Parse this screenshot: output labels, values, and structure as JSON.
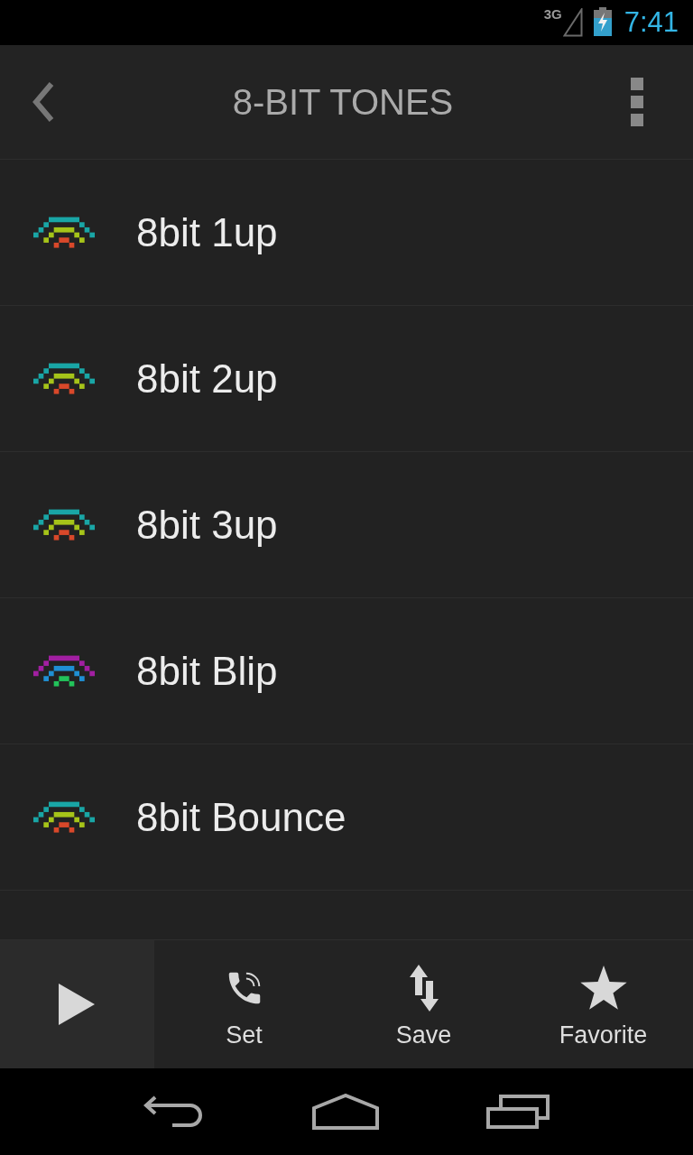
{
  "status_bar": {
    "network": "3G",
    "time": "7:41"
  },
  "action_bar": {
    "title": "8-BIT TONES"
  },
  "tones": [
    {
      "name": "8bit 1up",
      "icon_layers": [
        {
          "color": "#19a6a6"
        },
        {
          "color": "#a6c419"
        },
        {
          "color": "#d9482a"
        }
      ]
    },
    {
      "name": "8bit 2up",
      "icon_layers": [
        {
          "color": "#19a6a6"
        },
        {
          "color": "#a6c419"
        },
        {
          "color": "#d9482a"
        }
      ]
    },
    {
      "name": "8bit 3up",
      "icon_layers": [
        {
          "color": "#19a6a6"
        },
        {
          "color": "#a6c419"
        },
        {
          "color": "#d9482a"
        }
      ]
    },
    {
      "name": "8bit Blip",
      "icon_layers": [
        {
          "color": "#a21fa2"
        },
        {
          "color": "#1f8fd4"
        },
        {
          "color": "#22c35a"
        }
      ]
    },
    {
      "name": "8bit Bounce",
      "icon_layers": [
        {
          "color": "#19a6a6"
        },
        {
          "color": "#a6c419"
        },
        {
          "color": "#d9482a"
        }
      ]
    }
  ],
  "bottom_bar": {
    "actions": [
      {
        "kind": "play"
      },
      {
        "kind": "set",
        "label": "Set"
      },
      {
        "kind": "save",
        "label": "Save"
      },
      {
        "kind": "favorite",
        "label": "Favorite"
      }
    ]
  }
}
